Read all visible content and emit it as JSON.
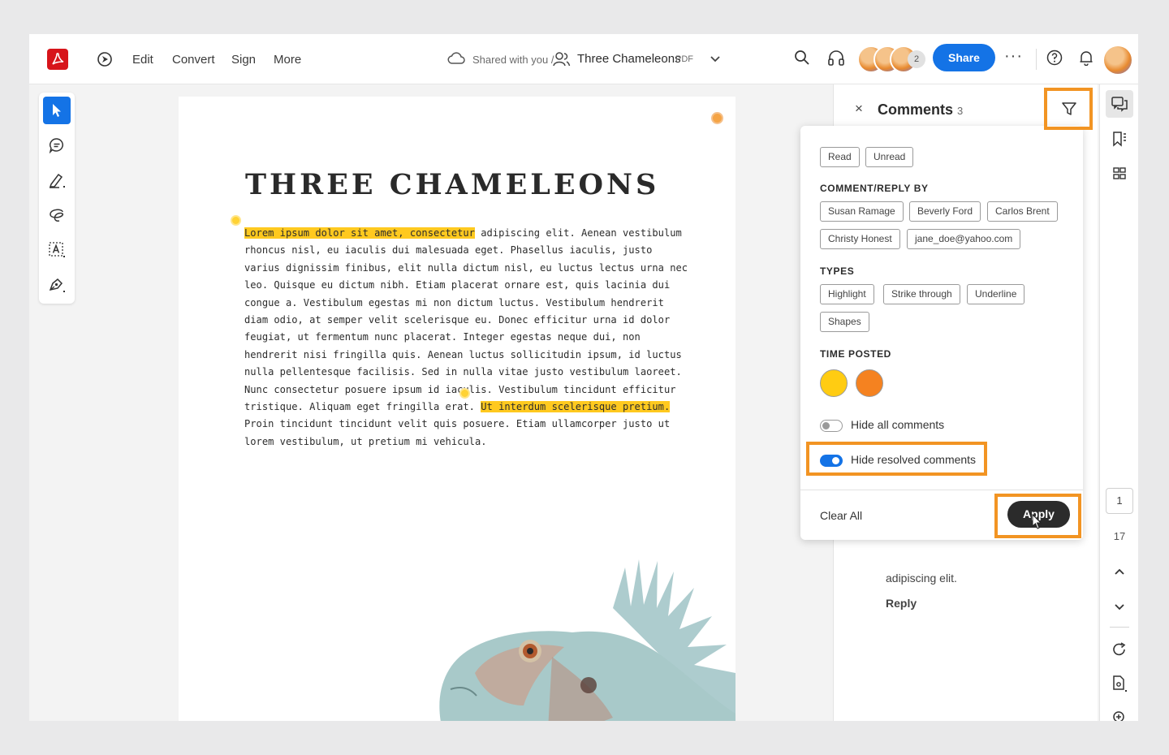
{
  "topbar": {
    "menu": [
      "Edit",
      "Convert",
      "Sign",
      "More"
    ],
    "breadcrumb": "Shared with you /",
    "doc_title": "Three Chameleons",
    "doc_type": "PDF",
    "collaborator_count": "2",
    "share_label": "Share",
    "more_label": "···"
  },
  "document": {
    "heading": "THREE CHAMELEONS",
    "highlight_1": "Lorem ipsum dolor sit amet, consectetur",
    "line_1_rest": " adipiscing elit. Aenean vestibulum",
    "lines_middle": "rhoncus nisl, eu iaculis dui malesuada eget. Phasellus iaculis, justo\nvarius dignissim finibus, elit nulla dictum nisl, eu luctus lectus urna nec\nleo. Quisque eu dictum nibh. Etiam placerat ornare est, quis lacinia dui\ncongue a. Vestibulum egestas mi non dictum luctus. Vestibulum hendrerit\ndiam odio, at semper velit scelerisque eu. Donec efficitur urna id dolor\nfeugiat, ut fermentum nunc placerat. Integer egestas neque dui, non\nhendrerit nisi fringilla quis. Aenean luctus sollicitudin ipsum, id luctus\nnulla pellentesque facilisis. Sed in nulla vitae justo vestibulum laoreet.\nNunc consectetur posuere ipsum id iaculis. Vestibulum tincidunt efficitur",
    "line_12_start": "tristique. Aliquam eget fringilla erat. ",
    "highlight_2": "Ut interdum scelerisque pretium.",
    "lines_end": "Proin tincidunt tincidunt velit quis posuere. Etiam ullamcorper justo ut\nlorem vestibulum, ut pretium mi vehicula."
  },
  "comments": {
    "title": "Comments",
    "count": "3",
    "close_label": "×",
    "snippet": "adipiscing elit.",
    "reply_label": "Reply"
  },
  "filter": {
    "status_chips": [
      "Read",
      "Unread"
    ],
    "by_heading": "COMMENT/REPLY BY",
    "people": [
      "Susan Ramage",
      "Beverly Ford",
      "Carlos Brent",
      "Christy Honest",
      "jane_doe@yahoo.com"
    ],
    "types_heading": "TYPES",
    "types": [
      "Highlight",
      "Strike through",
      "Underline",
      "Shapes"
    ],
    "time_heading": "TIME POSTED",
    "time_colors": [
      "#ffcc12",
      "#f58220"
    ],
    "hide_all_label": "Hide all comments",
    "hide_all_on": false,
    "hide_resolved_label": "Hide resolved comments",
    "hide_resolved_on": true,
    "clear_all_label": "Clear All",
    "apply_label": "Apply"
  },
  "rail": {
    "current_page": "1",
    "total_pages": "17"
  },
  "colors": {
    "accent": "#1473e6",
    "highlight": "#ffc91f",
    "callout_outline": "#f29423",
    "brand_red": "#d7141a"
  }
}
